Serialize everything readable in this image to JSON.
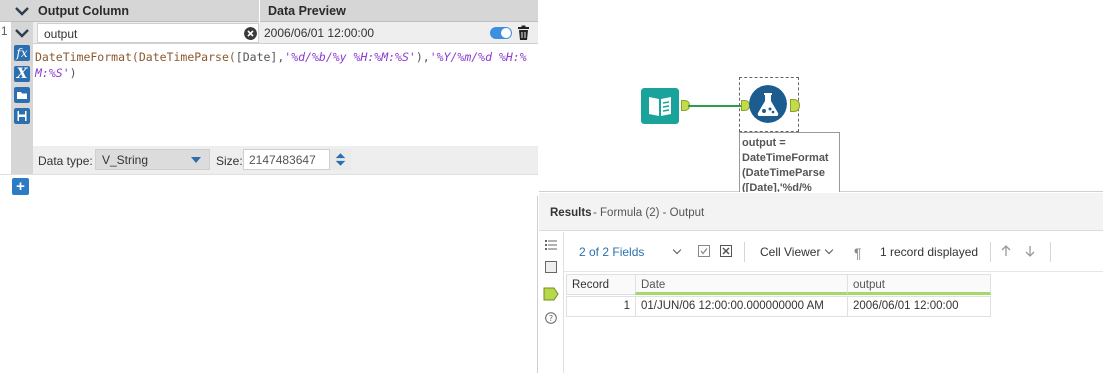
{
  "config": {
    "header": {
      "col_output": "Output Column",
      "col_preview": "Data Preview"
    },
    "row": {
      "number": "1",
      "output_value": "output",
      "preview_value": "2006/06/01 12:00:00",
      "enabled": true
    },
    "expression": {
      "fn1": "DateTimeFormat(",
      "fn2": "DateTimeParse(",
      "field": "[Date]",
      "sep1": ",",
      "str1": "'%d/%b/%y %H:%M:%S'",
      "sep2": "),",
      "str2": "'%Y/%m/%d %H:%M:%S'",
      "close": ")"
    },
    "tools": {
      "fx": "fx",
      "x": "X"
    },
    "type_row": {
      "type_label": "Data type:",
      "type_value": "V_String",
      "size_label": "Size:",
      "size_value": "2147483647"
    },
    "add_label": "+"
  },
  "canvas": {
    "annotation": "output =\nDateTimeFormat\n(DateTimeParse\n([Date],'%d/%"
  },
  "results": {
    "title": "Results",
    "subtitle": "- Formula (2) - Output",
    "fields_label": "2 of 2 Fields",
    "cell_viewer_label": "Cell Viewer",
    "records_label": "1 record displayed",
    "columns": [
      "Record",
      "Date",
      "output"
    ],
    "rows": [
      {
        "record": "1",
        "date": "01/JUN/06 12:00:00.000000000 AM",
        "output": "2006/06/01 12:00:00"
      }
    ]
  },
  "colors": {
    "accent_blue": "#2c6fb0",
    "connection_green": "#2e9e45",
    "input_tool_teal": "#1aa39b",
    "formula_tool_blue": "#1d5c8f",
    "anchor_yellow": "#c3da4a"
  }
}
